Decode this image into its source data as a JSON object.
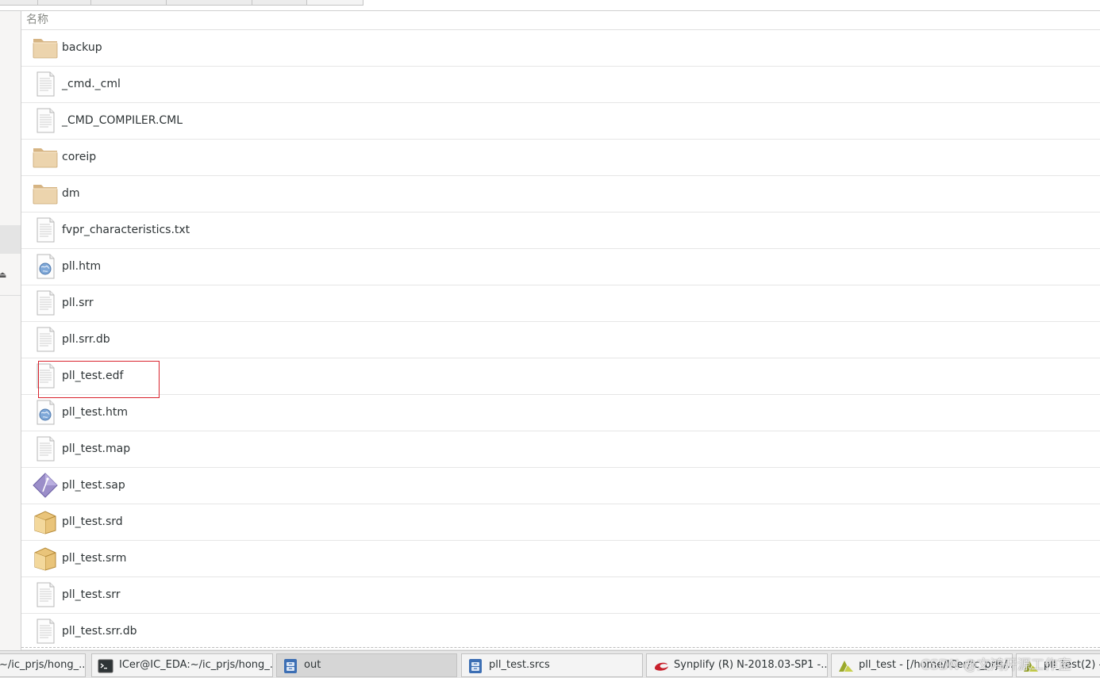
{
  "header": {
    "name_column": "名称"
  },
  "files": [
    {
      "name": "backup",
      "type": "folder"
    },
    {
      "name": "_cmd._cml",
      "type": "text"
    },
    {
      "name": "_CMD_COMPILER.CML",
      "type": "text"
    },
    {
      "name": "coreip",
      "type": "folder"
    },
    {
      "name": "dm",
      "type": "folder"
    },
    {
      "name": "fvpr_characteristics.txt",
      "type": "text"
    },
    {
      "name": "pll.htm",
      "type": "html"
    },
    {
      "name": "pll.srr",
      "type": "text"
    },
    {
      "name": "pll.srr.db",
      "type": "text"
    },
    {
      "name": "pll_test.edf",
      "type": "text"
    },
    {
      "name": "pll_test.htm",
      "type": "html"
    },
    {
      "name": "pll_test.map",
      "type": "text"
    },
    {
      "name": "pll_test.sap",
      "type": "diamond"
    },
    {
      "name": "pll_test.srd",
      "type": "package"
    },
    {
      "name": "pll_test.srm",
      "type": "package"
    },
    {
      "name": "pll_test.srr",
      "type": "text"
    },
    {
      "name": "pll_test.srr.db",
      "type": "text"
    }
  ],
  "taskbar": {
    "items": [
      {
        "label": "~/ic_prjs/hong_...",
        "icon": "none"
      },
      {
        "label": "ICer@IC_EDA:~/ic_prjs/hong_...",
        "icon": "terminal-icon"
      },
      {
        "label": "out",
        "icon": "file-manager-icon"
      },
      {
        "label": "pll_test.srcs",
        "icon": "file-manager-icon"
      },
      {
        "label": "Synplify (R) N-2018.03-SP1 -...",
        "icon": "synplify-icon"
      },
      {
        "label": "pll_test - [/home/ICer/ic_prjs/...",
        "icon": "vivado-icon"
      },
      {
        "label": "pll_test(2) -...",
        "icon": "vivado-icon"
      }
    ],
    "watermark": "CSDN @文鸿开源工作室"
  },
  "colors": {
    "highlight": "#d9232d",
    "folder": "#e8c99b",
    "active_task": "#d6d6d6"
  }
}
